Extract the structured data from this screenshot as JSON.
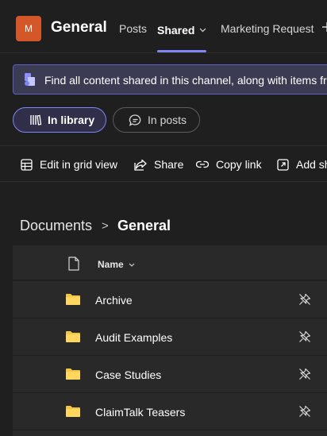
{
  "header": {
    "avatar_initial": "M",
    "avatar_color": "#d4572a",
    "channel_name": "General",
    "tabs": [
      {
        "label": "Posts",
        "active": false
      },
      {
        "label": "Shared",
        "active": true,
        "has_dropdown": true
      },
      {
        "label": "Marketing Request",
        "active": false
      }
    ],
    "accent_color": "#7f85f5"
  },
  "banner": {
    "icon": "shared-files-icon",
    "text": "Find all content shared in this channel, along with items fr"
  },
  "view_toggle": {
    "options": [
      {
        "label": "In library",
        "icon": "library-icon",
        "selected": true
      },
      {
        "label": "In posts",
        "icon": "chat-bubble-icon",
        "selected": false
      }
    ]
  },
  "toolbar": {
    "items": [
      {
        "label": "Edit in grid view",
        "icon": "grid-icon"
      },
      {
        "label": "Share",
        "icon": "share-icon"
      },
      {
        "label": "Copy link",
        "icon": "link-icon"
      },
      {
        "label": "Add sh",
        "icon": "open-external-icon"
      }
    ]
  },
  "breadcrumb": {
    "root": "Documents",
    "separator": ">",
    "current": "General"
  },
  "table": {
    "columns": [
      {
        "label": "Name",
        "sortable": true
      }
    ],
    "rows": [
      {
        "name": "Archive",
        "type": "folder",
        "action_icon": "unpin-icon"
      },
      {
        "name": "Audit Examples",
        "type": "folder",
        "action_icon": "unpin-icon"
      },
      {
        "name": "Case Studies",
        "type": "folder",
        "action_icon": "unpin-icon"
      },
      {
        "name": "ClaimTalk Teasers",
        "type": "folder",
        "action_icon": "unpin-icon"
      }
    ]
  }
}
